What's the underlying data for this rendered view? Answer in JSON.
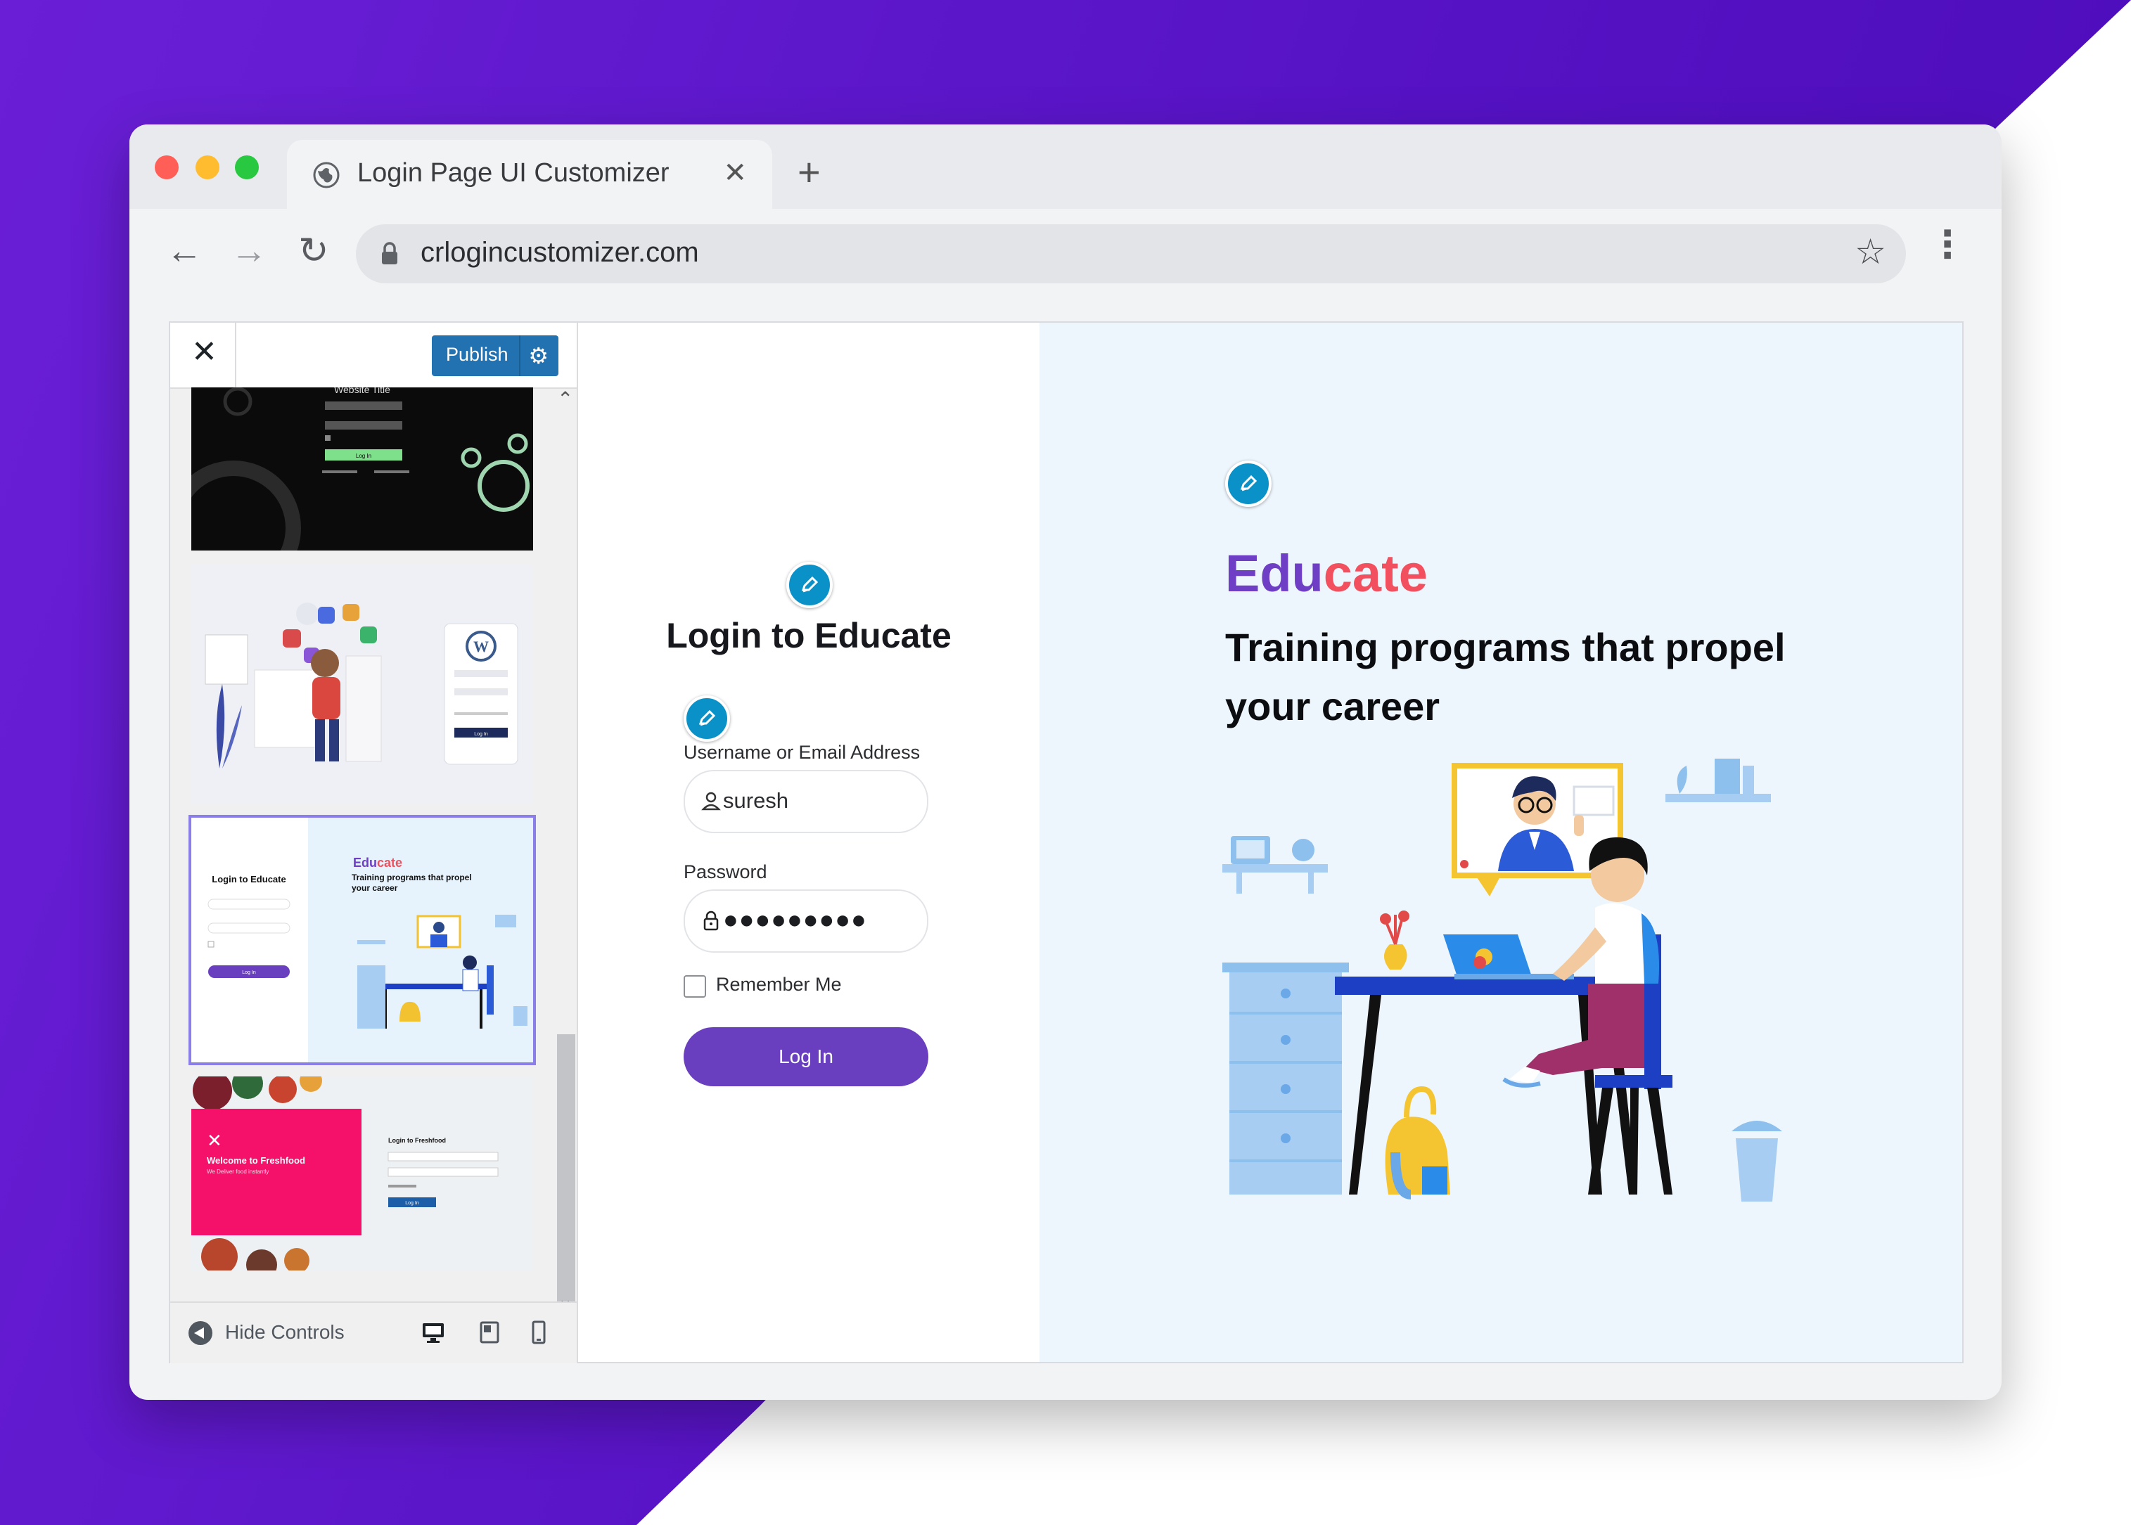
{
  "browser": {
    "tab_title": "Login Page UI Customizer",
    "tab_close": "✕",
    "new_tab": "+",
    "url": "crlogincustomizer.com",
    "nav": {
      "back": "←",
      "forward": "→",
      "reload": "↻"
    },
    "star": "☆",
    "menu": "⋮"
  },
  "customizer": {
    "close": "✕",
    "publish_label": "Publish",
    "publish_gear": "⚙",
    "hide_controls_label": "Hide Controls",
    "scroll_up": "⌃",
    "scroll_down": "⌄",
    "templates": [
      {
        "name": "dark-template",
        "title": "Website Title",
        "button": "Log In"
      },
      {
        "name": "illustration-template",
        "button": "Log In"
      },
      {
        "name": "educate-template",
        "selected": true,
        "login_title": "Login to Educate",
        "brand_a": "Edu",
        "brand_b": "cate",
        "tagline": "Training programs that propel your career",
        "button": "Log In"
      },
      {
        "name": "freshfood-template",
        "heading": "Welcome to Freshfood",
        "subheading": "We Deliver food instantly",
        "login_title": "Login to Freshfood",
        "button": "Log In"
      }
    ]
  },
  "login": {
    "title": "Login to Educate",
    "username_label": "Username or Email Address",
    "username_value": "suresh",
    "password_label": "Password",
    "password_value": "●●●●●●●●●",
    "remember_label": "Remember Me",
    "login_button": "Log In"
  },
  "hero": {
    "brand_a": "Edu",
    "brand_b": "cate",
    "tagline": "Training programs that propel your career"
  },
  "colors": {
    "accent_purple": "#6a3fbf",
    "brand_red": "#f2505e",
    "edit_blue": "#0a91c8",
    "publish_blue": "#2271b1"
  }
}
